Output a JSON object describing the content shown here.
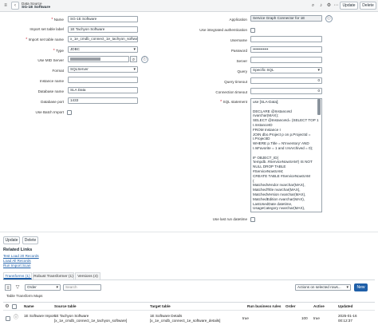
{
  "header": {
    "record_type": "Data Source",
    "record_name": "SG-1E Software",
    "update_label": "Update",
    "delete_label": "Delete"
  },
  "form": {
    "name_label": "Name",
    "name_value": "SG-1E Software",
    "import_set_label_label": "Import set table label",
    "import_set_label_value": "1E Tachyon Software",
    "import_set_name_label": "Import set table name",
    "import_set_name_value": "x_1e_cmdb_connect_1e_tachyon_software",
    "type_label": "Type",
    "type_value": "JDBC",
    "mid_server_label": "Use MID Server",
    "mid_server_value": "",
    "format_label": "Format",
    "format_value": "SQLServer",
    "instance_name_label": "Instance name",
    "instance_name_value": "",
    "database_name_label": "Database name",
    "database_name_value": "SLA Data",
    "database_port_label": "Database port",
    "database_port_value": "1433",
    "batch_import_label": "Use Batch Import",
    "application_label": "Application",
    "application_value": "Service Graph Connector for 1E",
    "integrated_auth_label": "Use integrated authentication",
    "username_label": "Username",
    "username_value": "",
    "password_label": "Password",
    "password_value": "••••••••••••",
    "server_label": "Server",
    "server_value": "",
    "query_label": "Query",
    "query_value": "Specific SQL",
    "query_timeout_label": "Query timeout",
    "query_timeout_value": "0",
    "connection_timeout_label": "Connection timeout",
    "connection_timeout_value": "0",
    "sql_statement_label": "SQL statement",
    "sql_statement_value": "use [SLA-Data];\n\nDECLARE @InstanceId\nnvarchar(MAX);\nSELECT @InstanceId= (SELECT TOP 1\nI.InstanceID\nFROM Instance I\nJOIN dbo.Project p on p.ProjectId =\nI.ProjectID\nWHERE p.Title = N'Inventory' AND\nI.IsFavorite = 1 and I.IsArchived = 0);\n\nIF OBJECT_ID(\n'tempdb..#ServiceNowSAM') IS NOT\nNULL DROP TABLE\n#ServiceNowSAM;\nCREATE TABLE #ServiceNowSAM\n(\nMatchedVendor nvarchar(MAX),\nMatchedTitle nvarchar(MAX),\nMatchedVersion nvarchar(MAX),\nMatchedEdition nvarchar(MAX),\nLastUsedDate datetime,\nUsageCategory nvarchar(MAX),",
    "last_run_label": "Use last run datetime"
  },
  "bottom_buttons": {
    "update_label": "Update",
    "delete_label": "Delete"
  },
  "related_links": {
    "heading": "Related Links",
    "links": [
      "Test Load 20 Records",
      "Load All Records",
      "Run Import Scan"
    ]
  },
  "tabs": [
    "Transforms (1)",
    "Robust Transformer (1)",
    "Versions (4)"
  ],
  "list_toolbar": {
    "field_select": "Order",
    "search_placeholder": "Search",
    "actions_label": "Actions on selected rows...",
    "new_label": "New",
    "breadcrumb": "Table Transform Maps"
  },
  "table": {
    "columns": [
      "Name",
      "Source table",
      "Target table",
      "Run business rules",
      "Order",
      "Active",
      "Updated"
    ],
    "rows": [
      {
        "name": "1E Software Import",
        "source_table": "1E Tachyon Software [x_1e_cmdb_connect_1e_tachyon_software]",
        "target_table": "1E Software Details [x_1e_cmdb_connect_1e_software_details]",
        "run_business_rules": "true",
        "order": "100",
        "active": "true",
        "updated": "2025-01-16 00:12:37"
      }
    ]
  },
  "colors": {
    "link": "#1f5fa8",
    "primary_button": "#1f5fa8",
    "required": "#cc2233"
  }
}
